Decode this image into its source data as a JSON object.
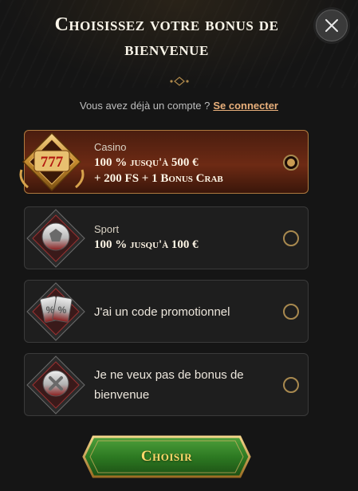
{
  "header": {
    "title": "Choisissez votre bonus de bienvenue",
    "close_icon": "close-icon"
  },
  "login": {
    "prompt": "Vous avez déjà un compte ?",
    "link": "Se connecter"
  },
  "options": [
    {
      "label": "Casino",
      "offer_line1": "100 % jusqu'à 500 €",
      "offer_line2": "+ 200 FS + 1 Bonus Crab",
      "icon": "slot-777-icon",
      "selected": true
    },
    {
      "label": "Sport",
      "offer_line1": "100 % jusqu'à 100 €",
      "icon": "soccer-ball-icon",
      "selected": false
    },
    {
      "text": "J'ai un code promotionnel",
      "icon": "promo-coupon-icon",
      "selected": false
    },
    {
      "text_line1": "Je ne veux pas de bonus de",
      "text_line2": "bienvenue",
      "icon": "no-bonus-icon",
      "selected": false
    }
  ],
  "cta": {
    "label": "Choisir"
  },
  "colors": {
    "accent_gold": "#c99b52",
    "selected_bg": "#6d2a14",
    "button_green": "#2f7a2a",
    "link": "#e9b07b"
  }
}
